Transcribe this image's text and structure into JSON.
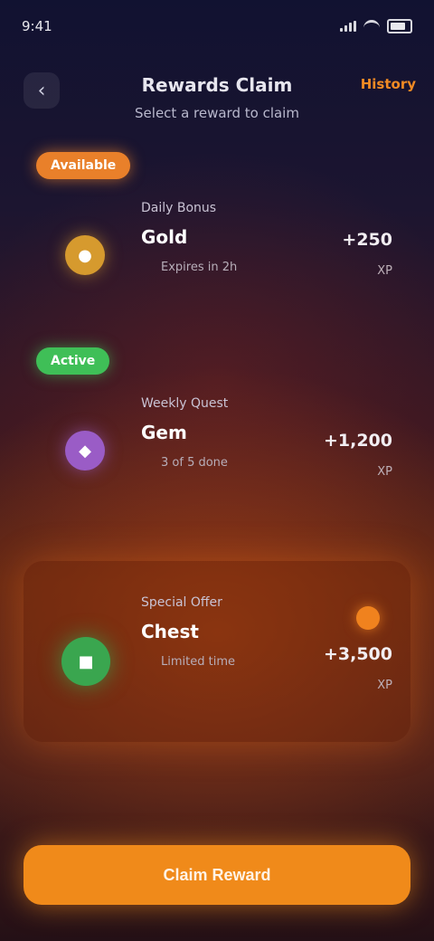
{
  "status": {
    "time": "9:41"
  },
  "header": {
    "title": "Rewards Claim",
    "subtitle": "Select a reward to claim",
    "action": "History"
  },
  "sections": [
    {
      "pill": "Available"
    },
    {
      "pill": "Active"
    }
  ],
  "cards": [
    {
      "label": "Daily Bonus",
      "name": "Gold",
      "meta": "Expires in 2h",
      "amount": "+250",
      "sub": "XP"
    },
    {
      "label": "Weekly Quest",
      "name": "Gem",
      "meta": "3 of 5 done",
      "amount": "+1,200",
      "sub": "XP"
    },
    {
      "label": "Special Offer",
      "name": "Chest",
      "meta": "Limited time",
      "amount": "+3,500",
      "sub": "XP"
    }
  ],
  "cta": {
    "label": "Claim Reward"
  },
  "icons": {
    "back": "back-icon",
    "gold": "coin-icon",
    "gem": "gem-icon",
    "chest": "chest-icon"
  },
  "colors": {
    "accent": "#f08a1a",
    "green": "#3fbf57",
    "purple": "#9a5cc6",
    "gold": "#d69a2e"
  }
}
